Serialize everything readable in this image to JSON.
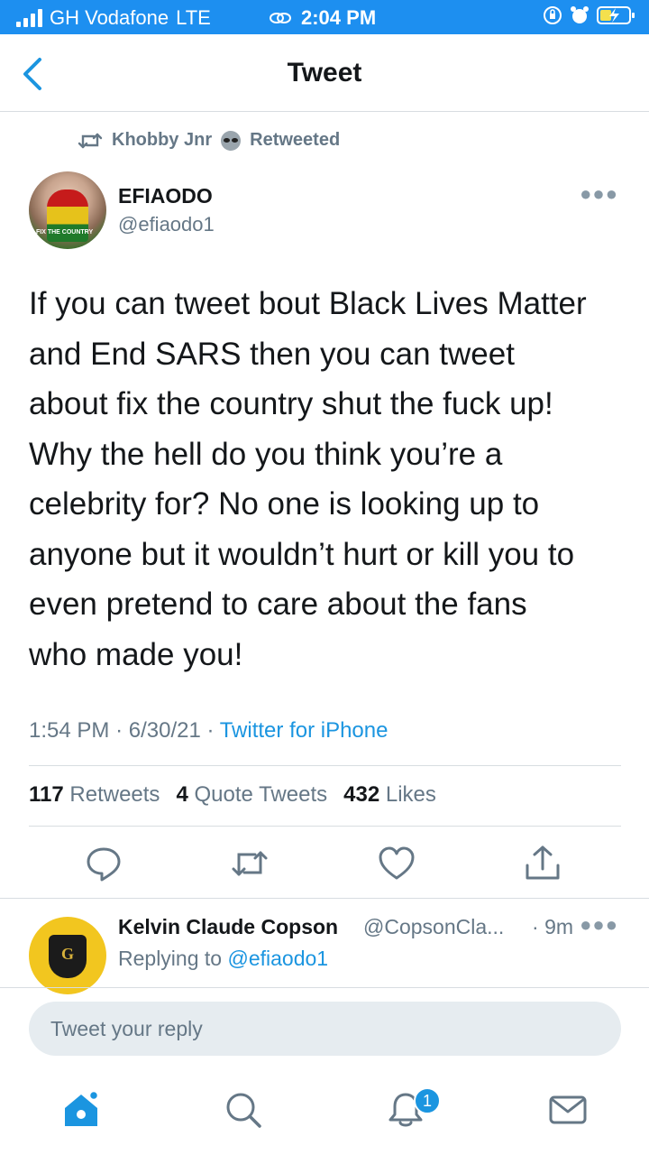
{
  "status_bar": {
    "carrier": "GH Vodafone",
    "network": "LTE",
    "time": "2:04 PM",
    "accent": "#1d8ff0"
  },
  "nav": {
    "title": "Tweet",
    "back_icon": "chevron-left-icon"
  },
  "retweet_header": {
    "user": "Khobby Jnr",
    "label": "Retweeted"
  },
  "tweet": {
    "author_name": "EFIAODO",
    "author_handle": "@efiaodo1",
    "avatar_text": "FIX THE COUNTRY",
    "text": "If you can tweet bout Black Lives Matter\nand End SARS then you can tweet\nabout fix the country shut the fuck up!\nWhy the hell do you think you’re a\ncelebrity for? No one is looking up to\nanyone but it wouldn’t hurt or kill you to\neven pretend to care about the fans\nwho made you!",
    "time": "1:54 PM",
    "date": "6/30/21",
    "source": "Twitter for iPhone",
    "stats": {
      "retweets_count": "117",
      "retweets_label": "Retweets",
      "quotes_count": "4",
      "quotes_label": "Quote Tweets",
      "likes_count": "432",
      "likes_label": "Likes"
    }
  },
  "reply": {
    "name": "Kelvin Claude Copson",
    "handle": "@CopsonCla...",
    "time": "9m",
    "replying_prefix": "Replying to",
    "replying_to": "@efiaodo1"
  },
  "composer": {
    "placeholder": "Tweet your reply"
  },
  "tabbar": {
    "notification_count": "1",
    "accent": "#1b95e0"
  }
}
